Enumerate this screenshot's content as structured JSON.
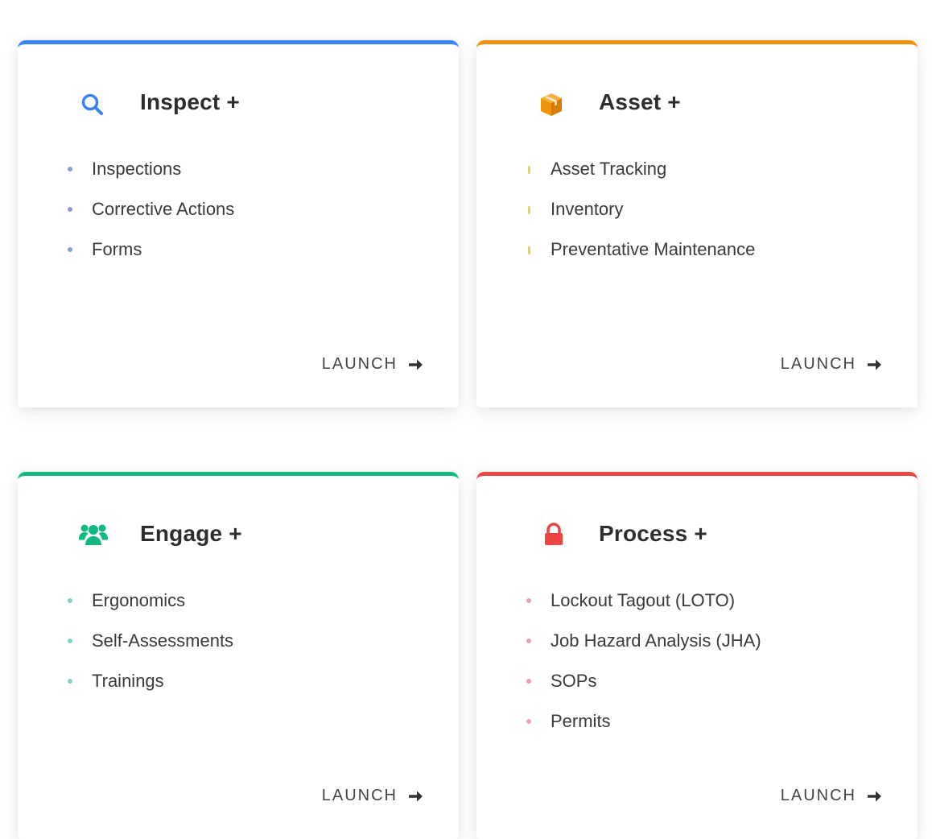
{
  "cards": [
    {
      "title": "Inspect +",
      "icon": "search-icon",
      "accent": "#3b82f6",
      "items": [
        "Inspections",
        "Corrective Actions",
        "Forms"
      ],
      "launch_label": "LAUNCH"
    },
    {
      "title": "Asset +",
      "icon": "box-icon",
      "accent": "#f0930a",
      "items": [
        "Asset Tracking",
        "Inventory",
        "Preventative Maintenance"
      ],
      "launch_label": "LAUNCH"
    },
    {
      "title": "Engage +",
      "icon": "users-icon",
      "accent": "#10b981",
      "items": [
        "Ergonomics",
        "Self-Assessments",
        "Trainings"
      ],
      "launch_label": "LAUNCH"
    },
    {
      "title": "Process +",
      "icon": "lock-icon",
      "accent": "#ef4444",
      "items": [
        "Lockout Tagout (LOTO)",
        "Job Hazard Analysis (JHA)",
        "SOPs",
        "Permits"
      ],
      "launch_label": "LAUNCH"
    }
  ]
}
